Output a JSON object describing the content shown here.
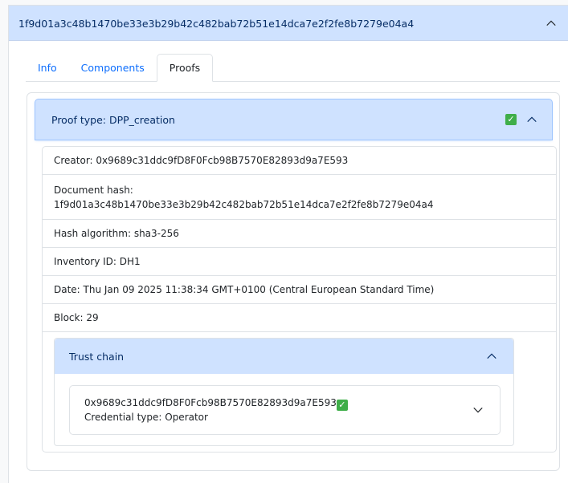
{
  "outer": {
    "title": "1f9d01a3c48b1470be33e3b29b42c482bab72b51e14dca7e2f2fe8b7279e04a4"
  },
  "tabs": [
    {
      "label": "Info"
    },
    {
      "label": "Components"
    },
    {
      "label": "Proofs"
    }
  ],
  "active_tab": "Proofs",
  "proof": {
    "header": "Proof type: DPP_creation",
    "status": "verified",
    "creator": "Creator: 0x9689c31ddc9fD8F0Fcb98B7570E82893d9a7E593",
    "document_hash_label": "Document hash:",
    "document_hash": "1f9d01a3c48b1470be33e3b29b42c482bab72b51e14dca7e2f2fe8b7279e04a4",
    "hash_algorithm": "Hash algorithm: sha3-256",
    "inventory_id": "Inventory ID: DH1",
    "date": "Date: Thu Jan 09 2025 11:38:34 GMT+0100 (Central European Standard Time)",
    "block": "Block: 29"
  },
  "trust_chain": {
    "title": "Trust chain",
    "items": [
      {
        "address": "0x9689c31ddc9fD8F0Fcb98B7570E82893d9a7E593",
        "credential_type": "Credential type: Operator"
      }
    ]
  },
  "icons": {
    "verified_check": "check-mark-button",
    "expand_up": "chevron-up",
    "expand_down": "chevron-down"
  },
  "colors": {
    "header_bg": "#cfe2ff",
    "header_text": "#052c65",
    "link": "#0d6efd",
    "check_green": "#3fae49"
  }
}
